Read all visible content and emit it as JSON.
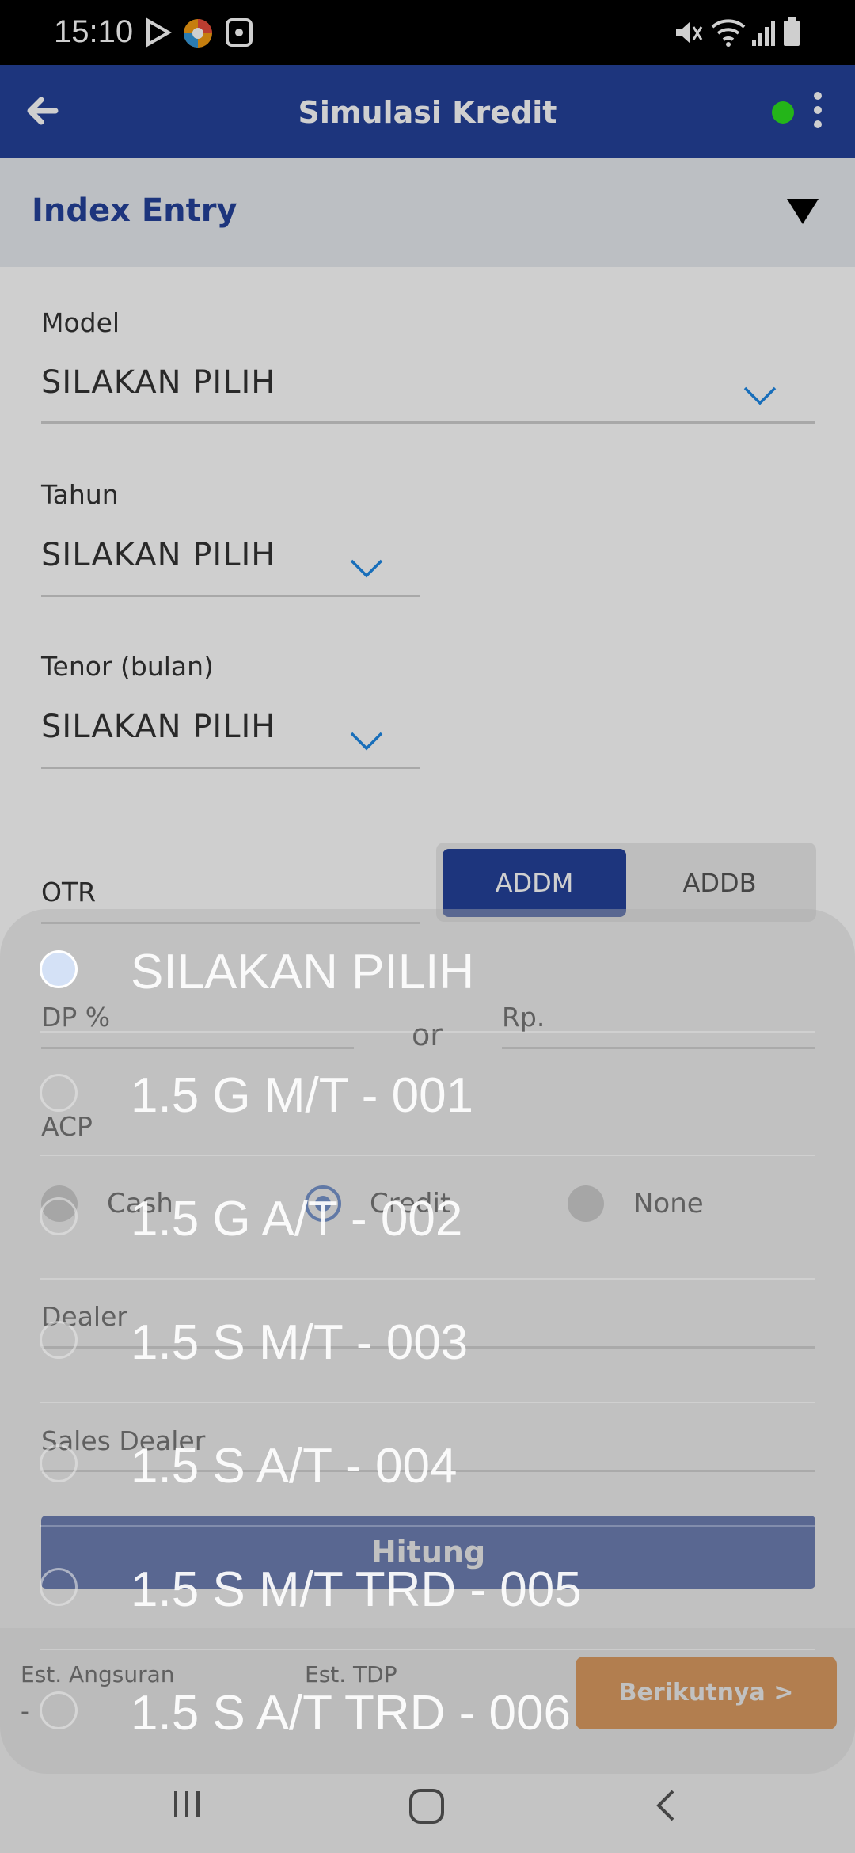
{
  "status_bar": {
    "time": "15:10"
  },
  "app_bar": {
    "title": "Simulasi Kredit"
  },
  "section": {
    "label": "Index Entry"
  },
  "form": {
    "model_label": "Model",
    "model_value": "SILAKAN PILIH",
    "tahun_label": "Tahun",
    "tahun_value": "SILAKAN PILIH",
    "tenor_label": "Tenor (bulan)",
    "tenor_value": "SILAKAN PILIH",
    "otr_label": "OTR",
    "segment": {
      "addm": "ADDM",
      "addb": "ADDB",
      "selected": "ADDM"
    },
    "dp_label": "DP %",
    "or_label": "or",
    "rp_label": "Rp.",
    "acp_label": "ACP",
    "acp_options": [
      "Cash",
      "Credit",
      "None"
    ],
    "acp_selected": "Credit",
    "dealer_label": "Dealer",
    "sales_dealer_label": "Sales Dealer",
    "hitung_label": "Hitung"
  },
  "bottom_bar": {
    "angsuran_label": "Est. Angsuran",
    "angsuran_value": "-",
    "tdp_label": "Est. TDP",
    "next_label": "Berikutnya >"
  },
  "picker": {
    "options": [
      "SILAKAN PILIH",
      "1.5 G M/T - 001",
      "1.5 G A/T - 002",
      "1.5 S M/T - 003",
      "1.5 S A/T - 004",
      "1.5 S M/T TRD - 005",
      "1.5 S A/T TRD - 006"
    ],
    "selected_index": 0
  }
}
